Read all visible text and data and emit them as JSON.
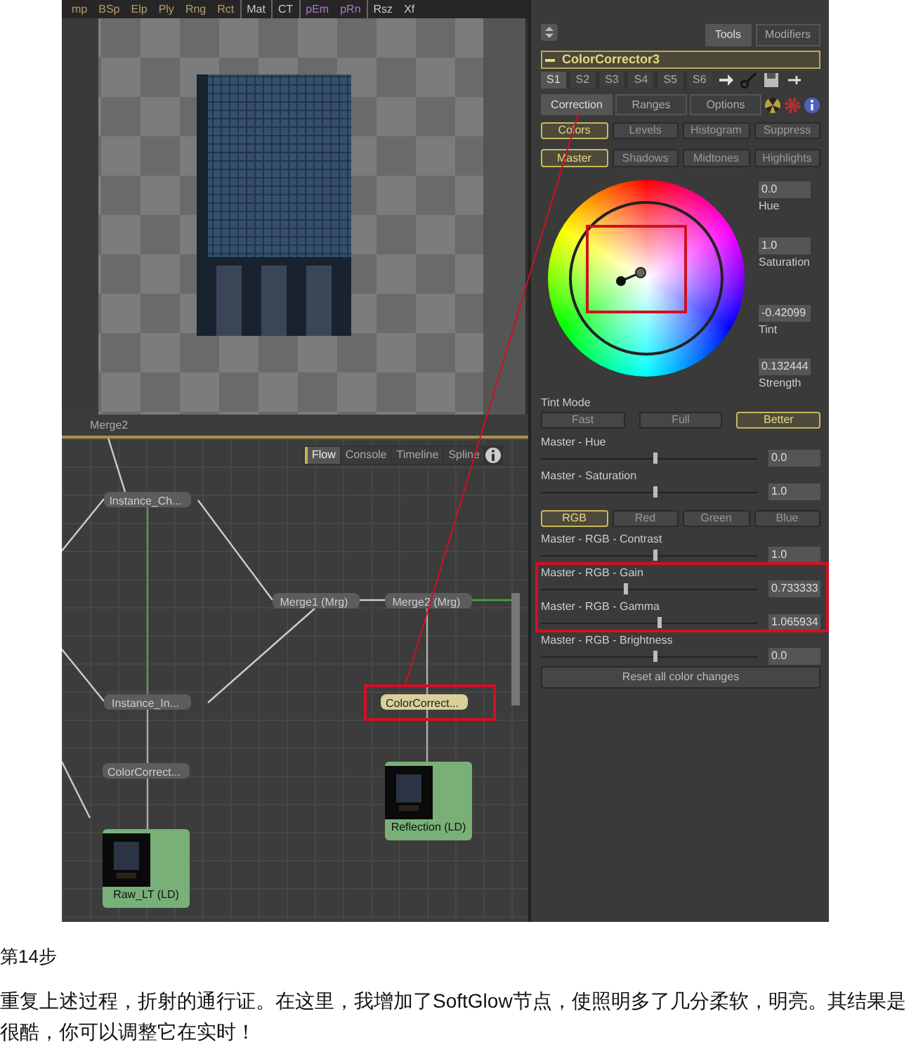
{
  "viewer": {
    "toolbar": [
      {
        "label": "mp",
        "kind": "mask",
        "separator_before": false
      },
      {
        "label": "BSp",
        "kind": "mask",
        "separator_before": false
      },
      {
        "label": "Elp",
        "kind": "mask",
        "separator_before": false
      },
      {
        "label": "Ply",
        "kind": "mask",
        "separator_before": false
      },
      {
        "label": "Rng",
        "kind": "mask",
        "separator_before": false
      },
      {
        "label": "Rct",
        "kind": "mask",
        "separator_before": false
      },
      {
        "label": "Mat",
        "kind": "tool",
        "separator_before": true
      },
      {
        "label": "CT",
        "kind": "tool",
        "separator_before": true
      },
      {
        "label": "pEm",
        "kind": "particle",
        "separator_before": true
      },
      {
        "label": "pRn",
        "kind": "particle",
        "separator_before": false
      },
      {
        "label": "Rsz",
        "kind": "tool",
        "separator_before": true
      },
      {
        "label": "Xf",
        "kind": "tool",
        "separator_before": false
      }
    ],
    "label": "Merge2"
  },
  "flow": {
    "tabs": [
      {
        "label": "Flow",
        "selected": true
      },
      {
        "label": "Console",
        "selected": false
      },
      {
        "label": "Timeline",
        "selected": false
      },
      {
        "label": "Spline",
        "selected": false
      }
    ],
    "nodes": [
      {
        "label": "Instance_Ch...",
        "kind": "tool",
        "selected": false
      },
      {
        "label": "Merge1 (Mrg)",
        "kind": "tool",
        "selected": false
      },
      {
        "label": "Merge2 (Mrg)",
        "kind": "tool",
        "selected": false
      },
      {
        "label": "Instance_In...",
        "kind": "tool",
        "selected": false
      },
      {
        "label": "ColorCorrect...",
        "kind": "tool",
        "selected": true
      },
      {
        "label": "ColorCorrect...",
        "kind": "tool",
        "selected": false
      },
      {
        "label": "Raw_LT (LD)",
        "kind": "loader",
        "selected": false
      },
      {
        "label": "Reflection (LD)",
        "kind": "loader",
        "selected": false
      }
    ]
  },
  "inspector": {
    "tabs": [
      {
        "label": "Tools",
        "selected": true
      },
      {
        "label": "Modifiers",
        "selected": false
      }
    ],
    "tool_name": "ColorCorrector3",
    "slots": [
      {
        "label": "S1",
        "selected": true
      },
      {
        "label": "S2",
        "selected": false
      },
      {
        "label": "S3",
        "selected": false
      },
      {
        "label": "S4",
        "selected": false
      },
      {
        "label": "S5",
        "selected": false
      },
      {
        "label": "S6",
        "selected": false
      }
    ],
    "section_tabs": [
      {
        "label": "Correction",
        "selected": true
      },
      {
        "label": "Ranges",
        "selected": false
      },
      {
        "label": "Options",
        "selected": false
      }
    ],
    "mode_buttons": [
      {
        "label": "Colors",
        "selected": true
      },
      {
        "label": "Levels",
        "selected": false
      },
      {
        "label": "Histogram",
        "selected": false
      },
      {
        "label": "Suppress",
        "selected": false
      }
    ],
    "range_buttons": [
      {
        "label": "Master",
        "selected": true
      },
      {
        "label": "Shadows",
        "selected": false
      },
      {
        "label": "Midtones",
        "selected": false
      },
      {
        "label": "Highlights",
        "selected": false
      }
    ],
    "wheel_fields": [
      {
        "label": "Hue",
        "value": "0.0"
      },
      {
        "label": "Saturation",
        "value": "1.0"
      },
      {
        "label": "Tint",
        "value": "-0.42099"
      },
      {
        "label": "Strength",
        "value": "0.132444"
      }
    ],
    "tint_mode": {
      "label": "Tint Mode",
      "options": [
        {
          "label": "Fast",
          "selected": false
        },
        {
          "label": "Full",
          "selected": false
        },
        {
          "label": "Better",
          "selected": true
        }
      ]
    },
    "sliders_top": [
      {
        "label": "Master - Hue",
        "value": "0.0",
        "level": 0.52
      },
      {
        "label": "Master - Saturation",
        "value": "1.0",
        "level": 0.52
      }
    ],
    "channels": [
      {
        "label": "RGB",
        "selected": true
      },
      {
        "label": "Red",
        "selected": false
      },
      {
        "label": "Green",
        "selected": false
      },
      {
        "label": "Blue",
        "selected": false
      }
    ],
    "sliders": [
      {
        "label": "Master - RGB - Contrast",
        "value": "1.0",
        "level": 0.52
      },
      {
        "label": "Master - RGB - Gain",
        "value": "0.733333",
        "level": 0.38
      },
      {
        "label": "Master - RGB - Gamma",
        "value": "1.065934",
        "level": 0.54
      },
      {
        "label": "Master - RGB - Brightness",
        "value": "0.0",
        "level": 0.52
      }
    ],
    "reset_button": "Reset all color changes"
  },
  "article": {
    "step": "第14步",
    "body": "重复上述过程，折射的通行证。在这里，我增加了SoftGlow节点，使照明多了几分柔软，明亮。其结果是很酷，你可以调整它在实时！"
  }
}
